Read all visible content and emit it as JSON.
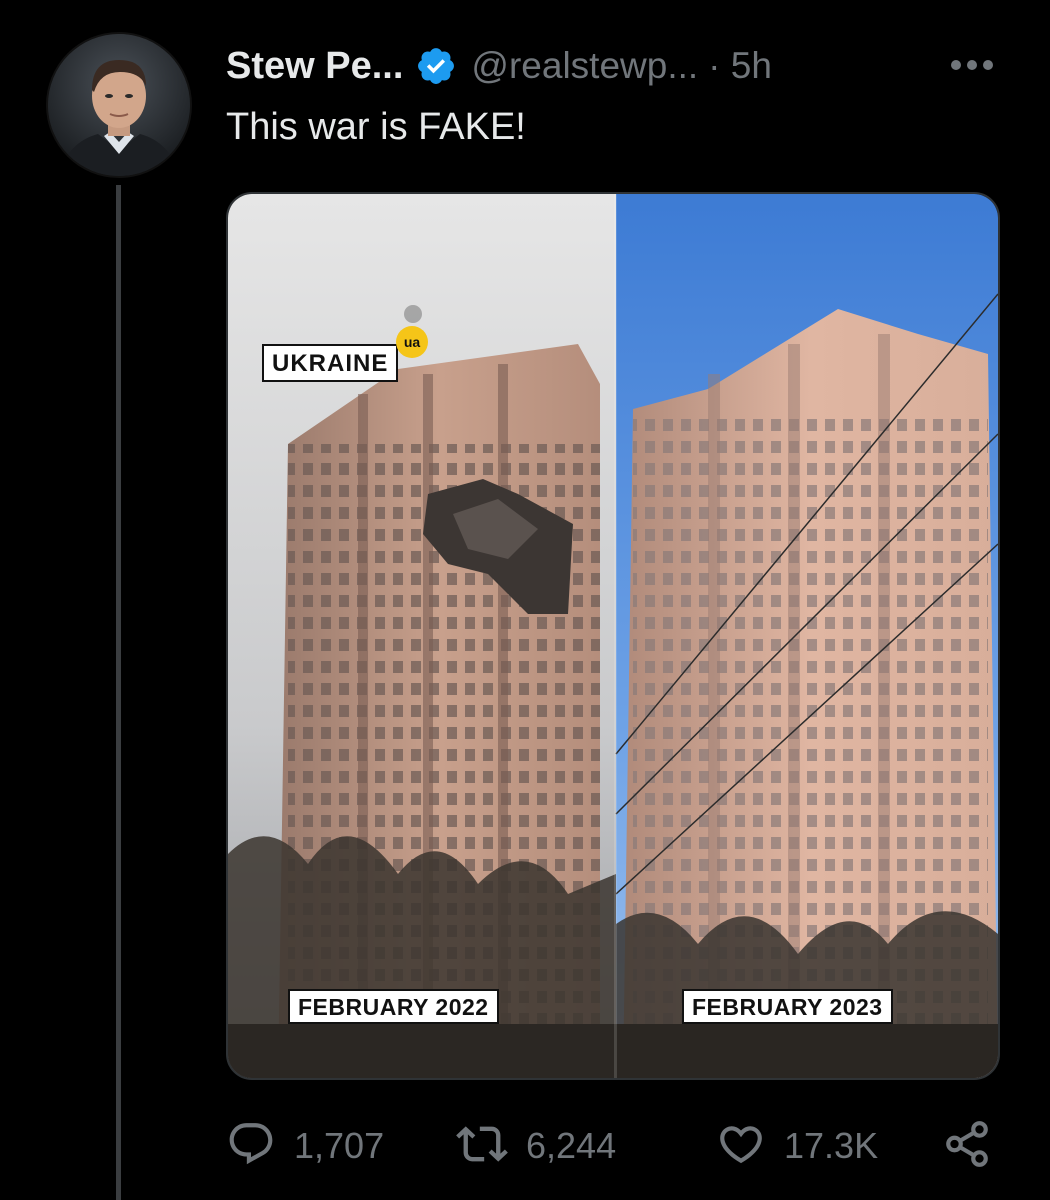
{
  "tweet": {
    "display_name": "Stew Pe...",
    "handle": "@realstewp...",
    "time": "· 5h",
    "text": "This war is FAKE!",
    "verified": true
  },
  "media": {
    "left_badge_logo": "ua",
    "left_badge_label": "UKRAINE",
    "left_caption": "FEBRUARY 2022",
    "right_caption": "FEBRUARY 2023"
  },
  "actions": {
    "reply_count": "1,707",
    "retweet_count": "6,244",
    "like_count": "17.3K"
  },
  "colors": {
    "background": "#000000",
    "text_primary": "#e7e9ea",
    "text_secondary": "#71767b",
    "verified_blue": "#1d9bf0",
    "ua_badge_yellow": "#f5c518"
  },
  "icons": {
    "verified": "verified-badge-icon",
    "more": "more-horizontal-icon",
    "reply": "reply-icon",
    "retweet": "retweet-icon",
    "like": "heart-icon",
    "share": "share-icon"
  }
}
